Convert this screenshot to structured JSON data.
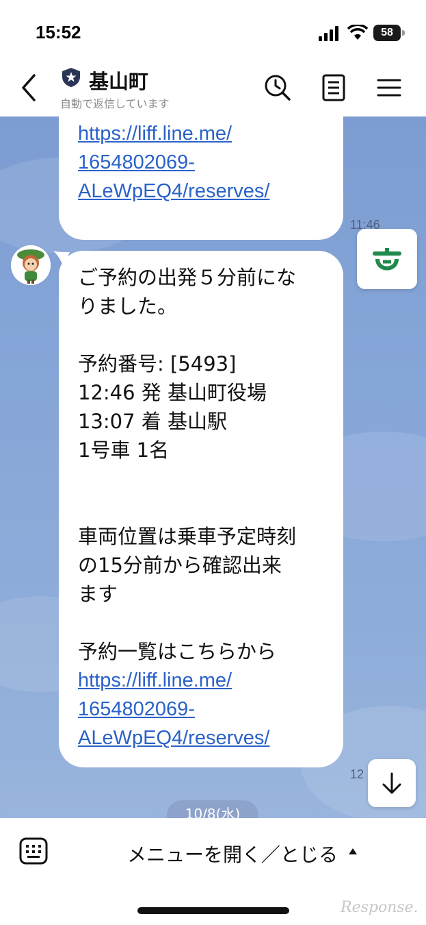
{
  "status_bar": {
    "time": "15:52",
    "battery": "58"
  },
  "header": {
    "title": "基山町",
    "subtitle": "自動で返信しています"
  },
  "chat": {
    "prev_message": {
      "link": "https://liff.line.me/\n1654802069-\nALeWpEQ4/reserves/",
      "timestamp": "11:46"
    },
    "message": {
      "text": "ご予約の出発５分前にな\nりました。\n\n予約番号: [5493]\n12:46 発 基山町役場\n13:07 着 基山駅\n1号車 1名\n\n\n車両位置は乗車予定時刻\nの15分前から確認出来\nます\n\n予約一覧はこちらから",
      "link": "https://liff.line.me/\n1654802069-\nALeWpEQ4/reserves/",
      "timestamp": "12"
    },
    "date_chip": "10/8(水)"
  },
  "bottom_bar": {
    "menu_label": "メニューを開く／とじる"
  },
  "watermark": "Response.",
  "colors": {
    "link": "#2a62c9",
    "chat_bg": "#7e9fd3",
    "town_green": "#1f8a4c"
  },
  "icons": [
    "signal-icon",
    "wifi-icon",
    "battery-icon",
    "back-icon",
    "shield-star-icon",
    "search-clock-icon",
    "notes-icon",
    "menu-icon",
    "town-emblem-icon",
    "scroll-down-icon",
    "keyboard-icon"
  ]
}
